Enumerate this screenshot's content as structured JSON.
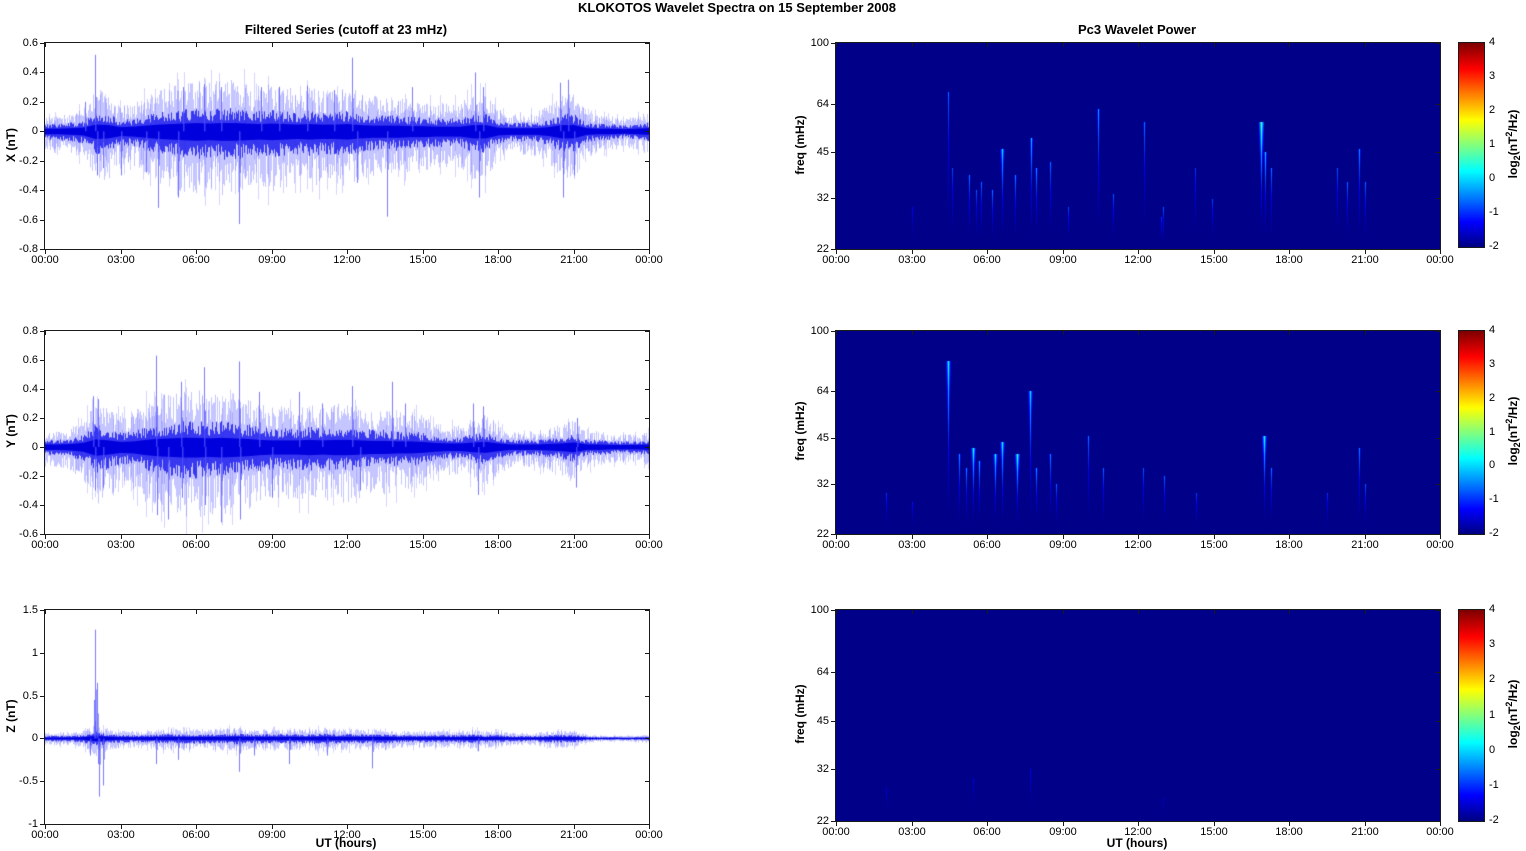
{
  "figure": {
    "title": "KLOKOTOS Wavelet Spectra on 15 September 2008",
    "left_column_title": "Filtered Series (cutoff at 23 mHz)",
    "right_column_title": "Pc3 Wavelet Power",
    "x_axis_label": "UT (hours)",
    "x_tick_hours": [
      0,
      3,
      6,
      9,
      12,
      15,
      18,
      21,
      24
    ],
    "x_tick_labels": [
      "00:00",
      "03:00",
      "06:00",
      "09:00",
      "12:00",
      "15:00",
      "18:00",
      "21:00",
      "00:00"
    ],
    "colorbar": {
      "ticks": [
        4,
        3,
        2,
        1,
        0,
        -1,
        -2
      ],
      "tick_labels": [
        "4",
        "3",
        "2",
        "1",
        "0",
        "-1",
        "-2"
      ],
      "range": [
        -2,
        4
      ],
      "label_parts": {
        "prefix": "log",
        "sub": "2",
        "mid": "(nT",
        "sup": "2",
        "suffix": "/Hz)"
      }
    },
    "colors": {
      "line_blue": "#0000ee",
      "heatmap_background": "#000a8f",
      "axis": "#1a1a1a",
      "colorbar_top": "#7f0000",
      "colorbar_bottom": "#000080"
    }
  },
  "chart_data": [
    {
      "id": "ts-x",
      "type": "line",
      "title": "Filtered Series (cutoff at 23 mHz)",
      "ylabel": "X (nT)",
      "ylim": [
        -0.8,
        0.6
      ],
      "yticks": [
        0.6,
        0.4,
        0.2,
        0,
        -0.2,
        -0.4,
        -0.6,
        -0.8
      ],
      "ytick_labels": [
        "0.6",
        "0.4",
        "0.2",
        "0",
        "-0.2",
        "-0.4",
        "-0.6",
        "-0.8"
      ],
      "x_hours_range": [
        0,
        24
      ],
      "envelope_dt_hours": 0.5,
      "envelope": [
        0.05,
        0.05,
        0.06,
        0.07,
        0.13,
        0.12,
        0.08,
        0.09,
        0.11,
        0.13,
        0.14,
        0.15,
        0.16,
        0.15,
        0.16,
        0.16,
        0.15,
        0.14,
        0.15,
        0.14,
        0.13,
        0.14,
        0.13,
        0.13,
        0.14,
        0.12,
        0.11,
        0.11,
        0.11,
        0.1,
        0.1,
        0.09,
        0.09,
        0.09,
        0.12,
        0.12,
        0.07,
        0.06,
        0.06,
        0.06,
        0.08,
        0.12,
        0.12,
        0.06,
        0.05,
        0.05,
        0.04,
        0.05,
        0.06
      ],
      "spikes": [
        [
          1.6,
          0.2
        ],
        [
          2.0,
          0.52
        ],
        [
          2.05,
          -0.3
        ],
        [
          2.3,
          -0.25
        ],
        [
          3.0,
          -0.3
        ],
        [
          4.0,
          -0.28
        ],
        [
          4.5,
          -0.52
        ],
        [
          5.3,
          -0.45
        ],
        [
          5.5,
          0.3
        ],
        [
          6.3,
          0.32
        ],
        [
          7.0,
          0.3
        ],
        [
          7.7,
          -0.63
        ],
        [
          8.6,
          0.3
        ],
        [
          9.3,
          0.3
        ],
        [
          10.4,
          0.31
        ],
        [
          11.5,
          0.28
        ],
        [
          12.2,
          0.5
        ],
        [
          12.4,
          -0.35
        ],
        [
          13.6,
          -0.58
        ],
        [
          14.6,
          0.3
        ],
        [
          17.1,
          0.4
        ],
        [
          17.25,
          -0.45
        ],
        [
          17.4,
          0.3
        ],
        [
          20.45,
          0.33
        ],
        [
          20.6,
          -0.45
        ],
        [
          20.8,
          0.35
        ],
        [
          21.0,
          -0.3
        ]
      ]
    },
    {
      "id": "ts-y",
      "type": "line",
      "ylabel": "Y (nT)",
      "ylim": [
        -0.6,
        0.8
      ],
      "yticks": [
        0.8,
        0.6,
        0.4,
        0.2,
        0,
        -0.2,
        -0.4,
        -0.6
      ],
      "ytick_labels": [
        "0.8",
        "0.6",
        "0.4",
        "0.2",
        "0",
        "-0.2",
        "-0.4",
        "-0.6"
      ],
      "x_hours_range": [
        0,
        24
      ],
      "envelope_dt_hours": 0.5,
      "envelope": [
        0.05,
        0.05,
        0.06,
        0.08,
        0.15,
        0.13,
        0.1,
        0.11,
        0.14,
        0.16,
        0.17,
        0.18,
        0.18,
        0.17,
        0.18,
        0.17,
        0.16,
        0.14,
        0.13,
        0.13,
        0.13,
        0.14,
        0.13,
        0.14,
        0.14,
        0.13,
        0.12,
        0.12,
        0.11,
        0.11,
        0.1,
        0.08,
        0.07,
        0.07,
        0.09,
        0.1,
        0.07,
        0.05,
        0.05,
        0.05,
        0.06,
        0.07,
        0.09,
        0.05,
        0.05,
        0.04,
        0.04,
        0.04,
        0.05
      ],
      "spikes": [
        [
          1.9,
          0.35
        ],
        [
          2.0,
          -0.3
        ],
        [
          2.1,
          0.33
        ],
        [
          2.3,
          -0.28
        ],
        [
          4.4,
          0.63
        ],
        [
          4.45,
          -0.47
        ],
        [
          4.9,
          -0.5
        ],
        [
          5.4,
          0.45
        ],
        [
          5.45,
          -0.35
        ],
        [
          6.3,
          0.55
        ],
        [
          6.35,
          -0.4
        ],
        [
          7.0,
          -0.52
        ],
        [
          7.7,
          0.59
        ],
        [
          7.75,
          -0.5
        ],
        [
          8.5,
          0.38
        ],
        [
          9.0,
          -0.35
        ],
        [
          10.1,
          0.38
        ],
        [
          11.0,
          0.3
        ],
        [
          12.2,
          0.42
        ],
        [
          12.5,
          -0.3
        ],
        [
          13.8,
          0.45
        ],
        [
          14.3,
          0.3
        ],
        [
          17.0,
          0.3
        ],
        [
          17.2,
          -0.33
        ],
        [
          17.4,
          0.28
        ],
        [
          21.1,
          -0.28
        ],
        [
          21.15,
          0.2
        ]
      ]
    },
    {
      "id": "ts-z",
      "type": "line",
      "ylabel": "Z (nT)",
      "ylim": [
        -1,
        1.5
      ],
      "yticks": [
        1.5,
        1,
        0.5,
        0,
        -0.5,
        -1
      ],
      "ytick_labels": [
        "1.5",
        "1",
        "0.5",
        "0",
        "-0.5",
        "-1"
      ],
      "x_hours_range": [
        0,
        24
      ],
      "envelope_dt_hours": 0.5,
      "envelope": [
        0.03,
        0.03,
        0.03,
        0.04,
        0.08,
        0.05,
        0.04,
        0.04,
        0.04,
        0.05,
        0.05,
        0.05,
        0.05,
        0.05,
        0.05,
        0.06,
        0.05,
        0.05,
        0.05,
        0.05,
        0.05,
        0.05,
        0.06,
        0.05,
        0.05,
        0.05,
        0.05,
        0.05,
        0.04,
        0.04,
        0.04,
        0.04,
        0.04,
        0.04,
        0.05,
        0.04,
        0.04,
        0.03,
        0.03,
        0.03,
        0.04,
        0.04,
        0.04,
        0.02,
        0.015,
        0.015,
        0.015,
        0.015,
        0.02
      ],
      "spikes": [
        [
          1.8,
          -0.2
        ],
        [
          1.95,
          0.45
        ],
        [
          2.0,
          1.27
        ],
        [
          2.05,
          0.65
        ],
        [
          2.1,
          -0.3
        ],
        [
          2.15,
          -0.68
        ],
        [
          2.3,
          -0.55
        ],
        [
          4.4,
          -0.3
        ],
        [
          5.3,
          -0.25
        ],
        [
          7.7,
          -0.39
        ],
        [
          8.3,
          -0.2
        ],
        [
          9.7,
          -0.3
        ],
        [
          11.2,
          -0.2
        ],
        [
          13.0,
          -0.35
        ],
        [
          17.2,
          -0.15
        ]
      ]
    },
    {
      "id": "wav-x",
      "type": "heatmap",
      "title": "Pc3 Wavelet Power",
      "ylabel": "freq (mHz)",
      "yscale": "log",
      "ylim": [
        22,
        100
      ],
      "yticks": [
        100,
        64,
        45,
        32,
        22
      ],
      "ytick_labels": [
        "100",
        "64",
        "45",
        "32",
        "22"
      ],
      "x_hours_range": [
        0,
        24
      ],
      "value_range": [
        -2,
        4
      ],
      "background_value": -2,
      "streaks": [
        [
          3.0,
          30,
          -1.2
        ],
        [
          4.45,
          70,
          -0.6
        ],
        [
          4.6,
          40,
          -0.8
        ],
        [
          5.3,
          38,
          -0.5
        ],
        [
          5.55,
          34,
          -0.7
        ],
        [
          5.75,
          36,
          -0.6
        ],
        [
          6.2,
          34,
          -0.5
        ],
        [
          6.6,
          46,
          0.2
        ],
        [
          7.1,
          38,
          -0.4
        ],
        [
          7.75,
          50,
          0.0
        ],
        [
          7.95,
          40,
          -0.3
        ],
        [
          8.5,
          42,
          -0.5
        ],
        [
          9.2,
          30,
          -0.8
        ],
        [
          10.4,
          62,
          -0.2
        ],
        [
          11.0,
          33,
          -0.7
        ],
        [
          12.25,
          56,
          -0.5
        ],
        [
          12.9,
          28,
          -0.9
        ],
        [
          13.0,
          30,
          -0.7
        ],
        [
          14.25,
          40,
          -0.9
        ],
        [
          14.95,
          32,
          -0.8
        ],
        [
          16.9,
          56,
          0.8
        ],
        [
          17.05,
          45,
          0.0
        ],
        [
          17.3,
          40,
          -0.5
        ],
        [
          19.9,
          40,
          -0.7
        ],
        [
          20.3,
          36,
          -0.6
        ],
        [
          20.8,
          46,
          -0.3
        ],
        [
          21.0,
          36,
          -0.6
        ]
      ]
    },
    {
      "id": "wav-y",
      "type": "heatmap",
      "ylabel": "freq (mHz)",
      "yscale": "log",
      "ylim": [
        22,
        100
      ],
      "yticks": [
        100,
        64,
        45,
        32,
        22
      ],
      "ytick_labels": [
        "100",
        "64",
        "45",
        "32",
        "22"
      ],
      "x_hours_range": [
        0,
        24
      ],
      "value_range": [
        -2,
        4
      ],
      "background_value": -2,
      "streaks": [
        [
          2.0,
          30,
          -0.9
        ],
        [
          3.0,
          28,
          -1.1
        ],
        [
          4.45,
          80,
          0.4
        ],
        [
          4.9,
          40,
          -0.3
        ],
        [
          5.15,
          36,
          -0.4
        ],
        [
          5.45,
          42,
          0.5
        ],
        [
          5.7,
          38,
          -0.2
        ],
        [
          6.3,
          40,
          0.3
        ],
        [
          6.6,
          44,
          0.4
        ],
        [
          7.2,
          40,
          0.6
        ],
        [
          7.7,
          64,
          0.2
        ],
        [
          7.95,
          36,
          -0.3
        ],
        [
          8.5,
          40,
          -0.4
        ],
        [
          8.75,
          32,
          -0.6
        ],
        [
          10.0,
          46,
          -0.5
        ],
        [
          10.6,
          36,
          -0.6
        ],
        [
          12.2,
          36,
          -0.7
        ],
        [
          13.05,
          34,
          -0.6
        ],
        [
          14.3,
          30,
          -0.8
        ],
        [
          17.0,
          46,
          0.5
        ],
        [
          17.3,
          36,
          -0.5
        ],
        [
          19.5,
          30,
          -0.9
        ],
        [
          20.8,
          42,
          -0.4
        ],
        [
          21.0,
          32,
          -0.7
        ]
      ]
    },
    {
      "id": "wav-z",
      "type": "heatmap",
      "ylabel": "freq (mHz)",
      "yscale": "log",
      "ylim": [
        22,
        100
      ],
      "yticks": [
        100,
        64,
        45,
        32,
        22
      ],
      "ytick_labels": [
        "100",
        "64",
        "45",
        "32",
        "22"
      ],
      "x_hours_range": [
        0,
        24
      ],
      "value_range": [
        -2,
        4
      ],
      "background_value": -2,
      "streaks": [
        [
          2.0,
          28,
          -1.4
        ],
        [
          5.45,
          30,
          -1.4
        ],
        [
          7.7,
          32,
          -1.3
        ],
        [
          13.0,
          26,
          -1.5
        ]
      ]
    }
  ]
}
